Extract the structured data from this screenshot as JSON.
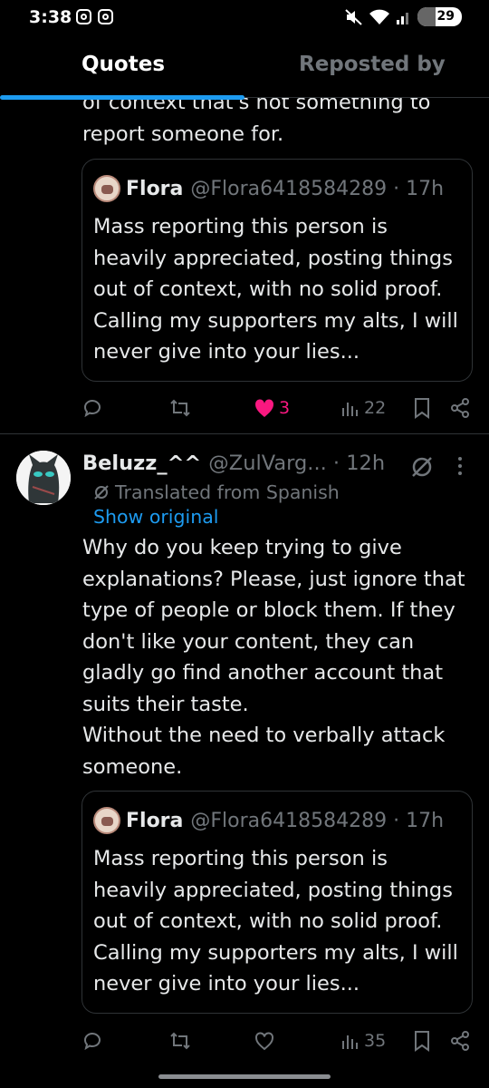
{
  "status_bar": {
    "time": "3:38",
    "battery": "29"
  },
  "tabs": [
    {
      "label": "Quotes"
    },
    {
      "label": "Reposted by"
    }
  ],
  "post1": {
    "text_tail": "of context that's not something to\nreport someone for.",
    "quote": {
      "name": "Flora",
      "meta": "@Flora6418584289 · 17h",
      "text": "Mass reporting this person is heavily appreciated, posting things out of context, with no solid proof. Calling my supporters my alts, I will never give into your lies..."
    },
    "actions": {
      "replies": "",
      "reposts": "",
      "likes": "3",
      "views": "22"
    }
  },
  "post2": {
    "name": "Beluzz_^^",
    "meta": "@ZulVarg... · 12h",
    "translated_label": "Translated from Spanish",
    "show_original": "Show original",
    "text": "Why do you keep trying to give explanations? Please, just ignore that type of people or block them. If they don't like your content, they can gladly go find another account that suits their taste.\nWithout the need to verbally attack someone.",
    "quote": {
      "name": "Flora",
      "meta": "@Flora6418584289 · 17h",
      "text": "Mass reporting this person is heavily appreciated, posting things out of context, with no solid proof. Calling my supporters my alts, I will never give into your lies..."
    },
    "actions": {
      "replies": "",
      "reposts": "",
      "likes": "",
      "views": "35"
    }
  },
  "colors": {
    "accent": "#1d9bf0",
    "like_active": "#f91880",
    "muted": "#71767b",
    "background": "#000000"
  }
}
